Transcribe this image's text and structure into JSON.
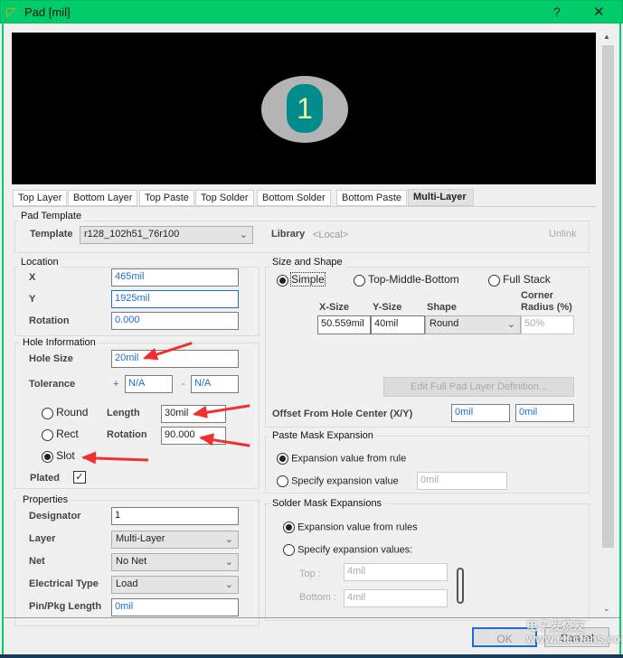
{
  "window": {
    "title": "Pad [mil]",
    "help": "?",
    "close": "✕"
  },
  "preview": {
    "pad_label": "1"
  },
  "tabs": [
    "Top Layer",
    "Bottom Layer",
    "Top Paste",
    "Top Solder",
    "Bottom Solder",
    "Bottom Paste",
    "Multi-Layer"
  ],
  "pad_template": {
    "title": "Pad Template",
    "template_label": "Template",
    "template_value": "r128_102h51_76r100",
    "library_label": "Library",
    "library_value": "<Local>",
    "unlink": "Unlink"
  },
  "location": {
    "title": "Location",
    "x_label": "X",
    "x": "465mil",
    "y_label": "Y",
    "y": "1925mil",
    "rotation_label": "Rotation",
    "rotation": "0.000"
  },
  "hole": {
    "title": "Hole Information",
    "size_label": "Hole Size",
    "size": "20mil",
    "tolerance_label": "Tolerance",
    "plus": "+",
    "minus": "-",
    "tol_plus": "N/A",
    "tol_minus": "N/A",
    "round": "Round",
    "rect": "Rect",
    "slot": "Slot",
    "length_label": "Length",
    "length": "30mil",
    "rotation_label": "Rotation",
    "rotation": "90.000",
    "plated_label": "Plated"
  },
  "properties": {
    "title": "Properties",
    "designator_label": "Designator",
    "designator": "1",
    "layer_label": "Layer",
    "layer": "Multi-Layer",
    "net_label": "Net",
    "net": "No Net",
    "etype_label": "Electrical Type",
    "etype": "Load",
    "pinlen_label": "Pin/Pkg Length",
    "pinlen": "0mil"
  },
  "size_shape": {
    "title": "Size and Shape",
    "simple": "Simple",
    "tmb": "Top-Middle-Bottom",
    "full": "Full Stack",
    "xsize_label": "X-Size",
    "ysize_label": "Y-Size",
    "shape_label": "Shape",
    "corner_label_1": "Corner",
    "corner_label_2": "Radius (%)",
    "xsize": "50.559mil",
    "ysize": "40mil",
    "shape": "Round",
    "corner": "50%",
    "edit_button": "Edit Full Pad Layer Definition...",
    "offset_label": "Offset From Hole Center (X/Y)",
    "offset_x": "0mil",
    "offset_y": "0mil"
  },
  "paste": {
    "title": "Paste Mask Expansion",
    "from_rule": "Expansion value from rule",
    "specify": "Specify expansion value",
    "value": "0mil"
  },
  "solder": {
    "title": "Solder Mask Expansions",
    "from_rules": "Expansion value from rules",
    "specify": "Specify expansion values:",
    "top_label": "Top :",
    "top": "4mil",
    "bottom_label": "Bottom :",
    "bottom": "4mil"
  },
  "buttons": {
    "ok": "OK",
    "cancel": "Cancel"
  },
  "watermark": "电子发烧友 www.elecfans.com"
}
